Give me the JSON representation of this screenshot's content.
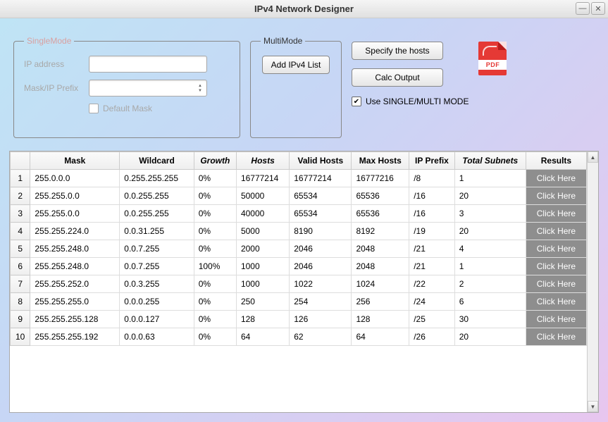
{
  "window": {
    "title": "IPv4 Network Designer"
  },
  "single": {
    "legend": "SingleMode",
    "ip_label": "IP address",
    "mask_label": "Mask/IP Prefix",
    "default_mask": "Default Mask"
  },
  "multi": {
    "legend": "MultiMode",
    "add_button": "Add IPv4 List"
  },
  "actions": {
    "specify": "Specify the hosts",
    "calc": "Calc Output",
    "pdf_label": "PDF",
    "mode_checkbox": "Use SINGLE/MULTI  MODE"
  },
  "table": {
    "headers": {
      "mask": "Mask",
      "wildcard": "Wildcard",
      "growth": "Growth",
      "hosts": "Hosts",
      "valid": "Valid Hosts",
      "max": "Max Hosts",
      "prefix": "IP Prefix",
      "subnets": "Total Subnets",
      "results": "Results"
    },
    "results_label": "Click Here",
    "rows": [
      {
        "n": "1",
        "mask": "255.0.0.0",
        "wildcard": "0.255.255.255",
        "growth": "0%",
        "hosts": "16777214",
        "valid": "16777214",
        "max": "16777216",
        "prefix": "/8",
        "subnets": "1"
      },
      {
        "n": "2",
        "mask": "255.255.0.0",
        "wildcard": "0.0.255.255",
        "growth": "0%",
        "hosts": "50000",
        "valid": "65534",
        "max": "65536",
        "prefix": "/16",
        "subnets": "20"
      },
      {
        "n": "3",
        "mask": "255.255.0.0",
        "wildcard": "0.0.255.255",
        "growth": "0%",
        "hosts": "40000",
        "valid": "65534",
        "max": "65536",
        "prefix": "/16",
        "subnets": "3"
      },
      {
        "n": "4",
        "mask": "255.255.224.0",
        "wildcard": "0.0.31.255",
        "growth": "0%",
        "hosts": "5000",
        "valid": "8190",
        "max": "8192",
        "prefix": "/19",
        "subnets": "20"
      },
      {
        "n": "5",
        "mask": "255.255.248.0",
        "wildcard": "0.0.7.255",
        "growth": "0%",
        "hosts": "2000",
        "valid": "2046",
        "max": "2048",
        "prefix": "/21",
        "subnets": "4"
      },
      {
        "n": "6",
        "mask": "255.255.248.0",
        "wildcard": "0.0.7.255",
        "growth": "100%",
        "hosts": "1000",
        "valid": "2046",
        "max": "2048",
        "prefix": "/21",
        "subnets": "1"
      },
      {
        "n": "7",
        "mask": "255.255.252.0",
        "wildcard": "0.0.3.255",
        "growth": "0%",
        "hosts": "1000",
        "valid": "1022",
        "max": "1024",
        "prefix": "/22",
        "subnets": "2"
      },
      {
        "n": "8",
        "mask": "255.255.255.0",
        "wildcard": "0.0.0.255",
        "growth": "0%",
        "hosts": "250",
        "valid": "254",
        "max": "256",
        "prefix": "/24",
        "subnets": "6"
      },
      {
        "n": "9",
        "mask": "255.255.255.128",
        "wildcard": "0.0.0.127",
        "growth": "0%",
        "hosts": "128",
        "valid": "126",
        "max": "128",
        "prefix": "/25",
        "subnets": "30"
      },
      {
        "n": "10",
        "mask": "255.255.255.192",
        "wildcard": "0.0.0.63",
        "growth": "0%",
        "hosts": "64",
        "valid": "62",
        "max": "64",
        "prefix": "/26",
        "subnets": "20"
      }
    ]
  }
}
